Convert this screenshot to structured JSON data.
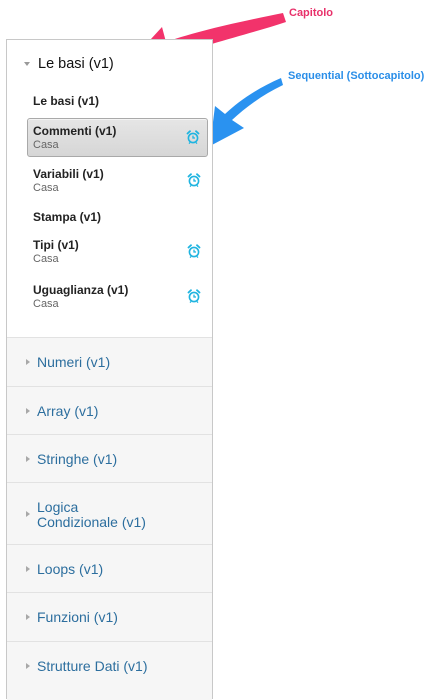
{
  "annotations": {
    "chapter_label": "Capitolo",
    "subchapter_label": "Sequential (Sottocapitolo)",
    "chapter_color": "#f2336b",
    "subchapter_color": "#2a92f0"
  },
  "sidebar": {
    "open_chapter": {
      "title": "Le basi (v1)",
      "section_title": "Le basi (v1)",
      "subsections": [
        {
          "title": "Commenti (v1)",
          "meta": "Casa",
          "has_alarm": true,
          "active": true
        },
        {
          "title": "Variabili (v1)",
          "meta": "Casa",
          "has_alarm": true,
          "active": false
        },
        {
          "title": "Stampa (v1)",
          "meta": "",
          "has_alarm": false,
          "active": false
        },
        {
          "title": "Tipi (v1)",
          "meta": "Casa",
          "has_alarm": true,
          "active": false
        },
        {
          "title": "Uguaglianza (v1)",
          "meta": "Casa",
          "has_alarm": true,
          "active": false
        }
      ]
    },
    "chapters": [
      {
        "title": "Numeri (v1)"
      },
      {
        "title": "Array (v1)"
      },
      {
        "title": "Stringhe (v1)"
      },
      {
        "title": "Logica Condizionale (v1)"
      },
      {
        "title": "Loops (v1)"
      },
      {
        "title": "Funzioni (v1)"
      },
      {
        "title": "Strutture Dati (v1)"
      }
    ],
    "colors": {
      "chapter_link": "#2c6e9e",
      "alarm_icon": "#1fb4e0"
    }
  }
}
